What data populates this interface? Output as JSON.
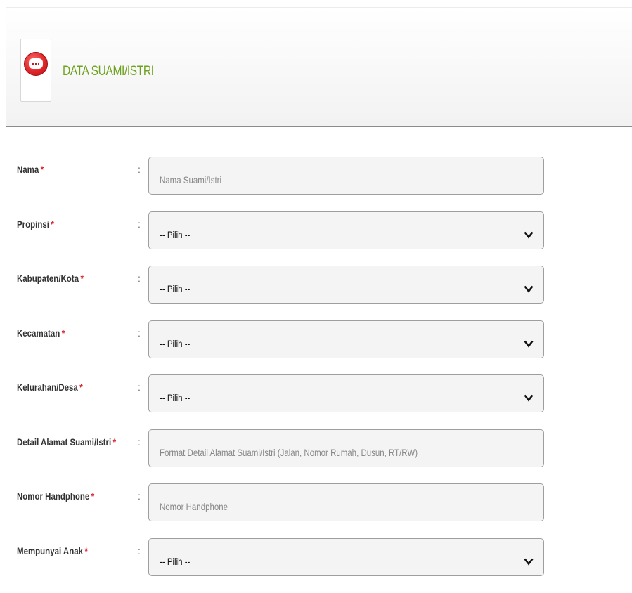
{
  "header": {
    "title": "DATA SUAMI/ISTRI"
  },
  "form": {
    "separator": ":",
    "required_mark": "*",
    "fields": [
      {
        "label": "Nama",
        "type": "text",
        "placeholder": "Nama Suami/Istri"
      },
      {
        "label": "Propinsi",
        "type": "select",
        "value": "-- Pilih --"
      },
      {
        "label": "Kabupaten/Kota",
        "type": "select",
        "value": "-- Pilih --"
      },
      {
        "label": "Kecamatan",
        "type": "select",
        "value": "-- Pilih --"
      },
      {
        "label": "Kelurahan/Desa",
        "type": "select",
        "value": "-- Pilih --"
      },
      {
        "label": "Detail Alamat Suami/Istri",
        "type": "text",
        "placeholder": "Format Detail Alamat Suami/Istri (Jalan, Nomor Rumah, Dusun, RT/RW)"
      },
      {
        "label": "Nomor Handphone",
        "type": "text",
        "placeholder": "Nomor Handphone"
      },
      {
        "label": "Mempunyai Anak",
        "type": "select",
        "value": "-- Pilih --"
      }
    ]
  },
  "colors": {
    "title_green": "#6ea11f",
    "required_red": "#d9232d",
    "field_border": "#9e9e9e",
    "field_bg": "#f4f4f4"
  },
  "icons": {
    "logo": "logo-icon",
    "select_arrow": "chevron-down-icon"
  }
}
